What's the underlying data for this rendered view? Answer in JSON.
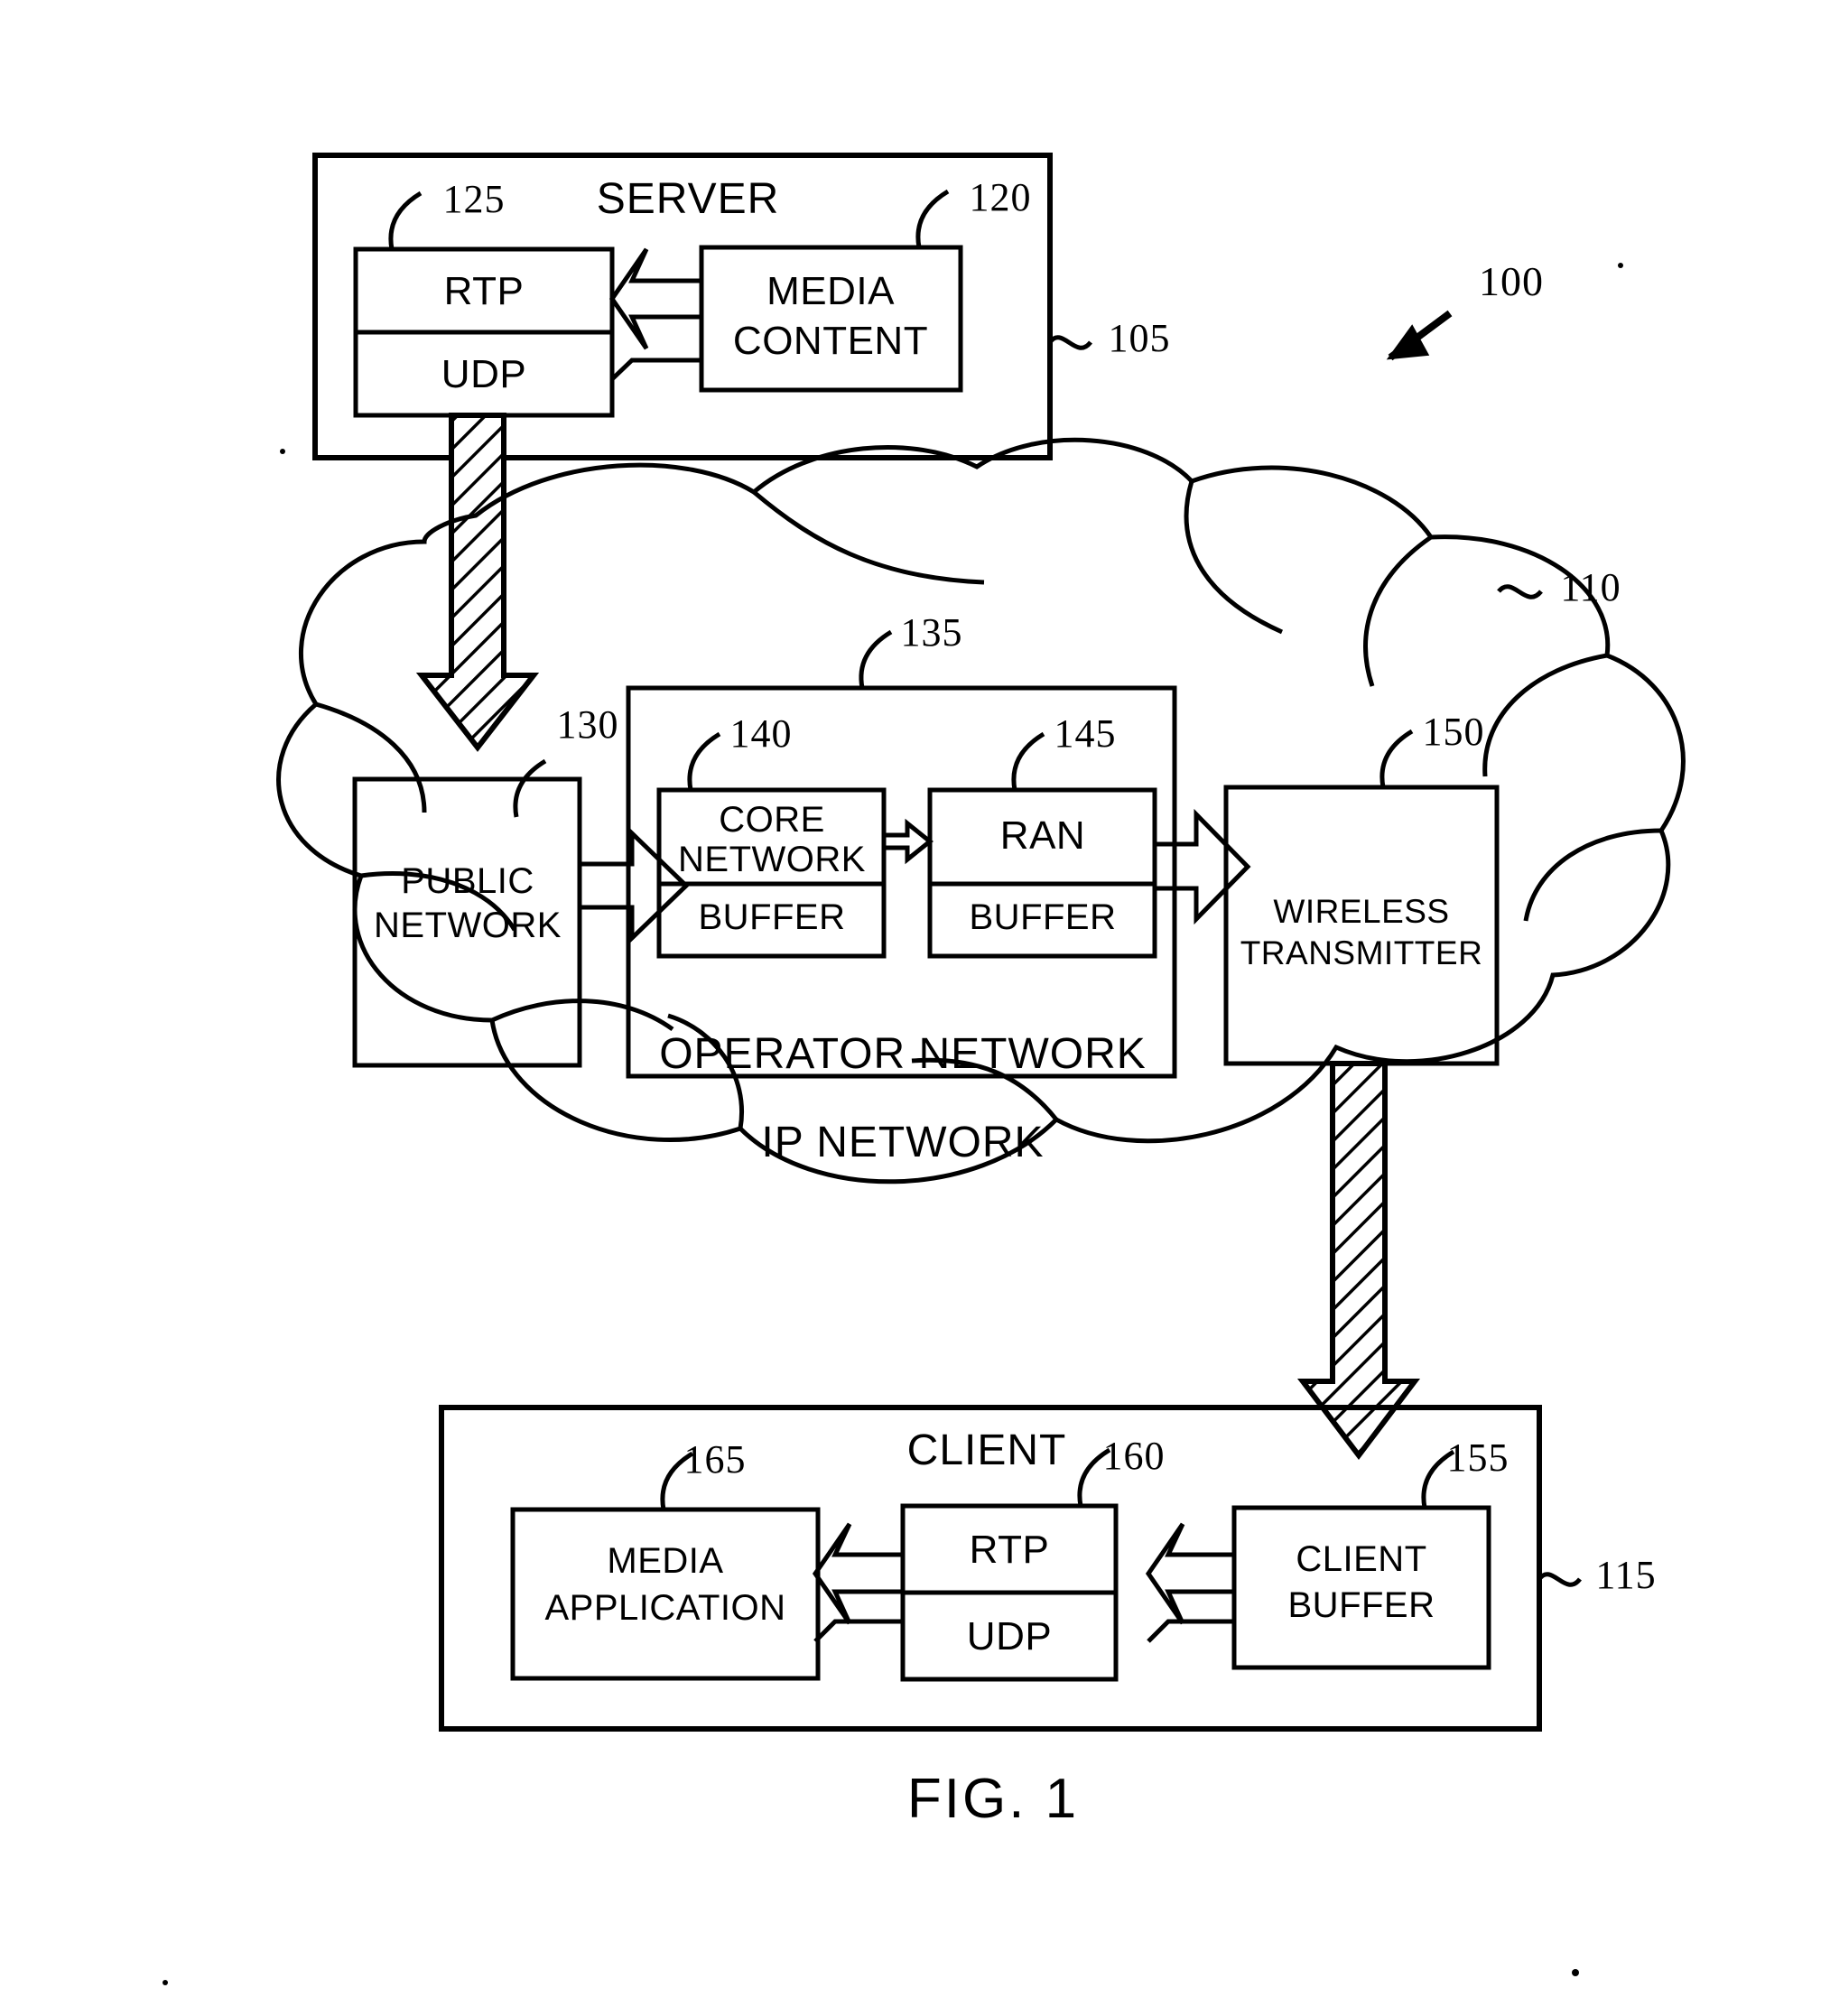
{
  "figure": {
    "caption": "FIG. 1",
    "system_ref": "100"
  },
  "server": {
    "title": "SERVER",
    "ref": "105",
    "rtp": {
      "label": "RTP",
      "ref": "125"
    },
    "udp": {
      "label": "UDP"
    },
    "media_content": {
      "label_line1": "MEDIA",
      "label_line2": "CONTENT",
      "ref": "120"
    }
  },
  "network": {
    "ip_network_label": "IP NETWORK",
    "cloud_ref": "110",
    "public_network": {
      "label_line1": "PUBLIC",
      "label_line2": "NETWORK",
      "ref": "130"
    },
    "operator_network": {
      "label": "OPERATOR NETWORK",
      "ref": "135"
    },
    "core_network": {
      "label_line1": "CORE",
      "label_line2": "NETWORK",
      "buffer_label": "BUFFER",
      "ref": "140"
    },
    "ran": {
      "label": "RAN",
      "buffer_label": "BUFFER",
      "ref": "145"
    },
    "wireless_transmitter": {
      "label_line1": "WIRELESS",
      "label_line2": "TRANSMITTER",
      "ref": "150"
    }
  },
  "client": {
    "title": "CLIENT",
    "ref": "115",
    "media_application": {
      "label_line1": "MEDIA",
      "label_line2": "APPLICATION",
      "ref": "165"
    },
    "rtp": {
      "label": "RTP",
      "ref": "160"
    },
    "udp": {
      "label": "UDP"
    },
    "client_buffer": {
      "label_line1": "CLIENT",
      "label_line2": "BUFFER",
      "ref": "155"
    }
  },
  "colors": {
    "ink": "#000000",
    "paper": "#ffffff"
  }
}
